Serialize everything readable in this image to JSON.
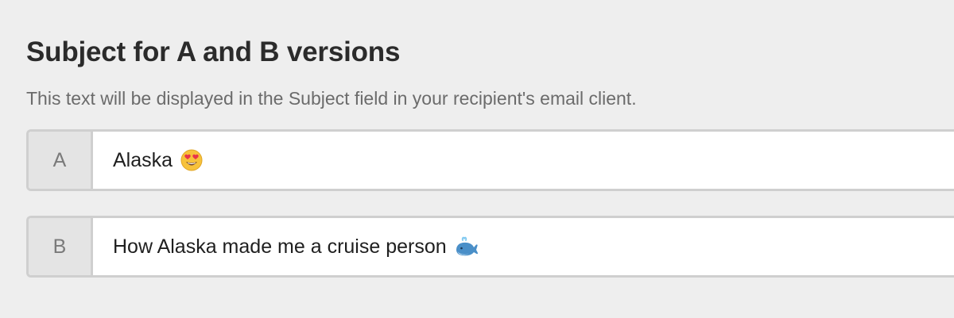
{
  "section": {
    "title": "Subject for A and B versions",
    "helper_text": "This text will be displayed in the Subject field in your recipient's email client."
  },
  "variants": [
    {
      "label": "A",
      "subject": "Alaska",
      "emoji_icon": "heart-eyes-emoji-icon"
    },
    {
      "label": "B",
      "subject": "How Alaska made me a cruise person",
      "emoji_icon": "whale-emoji-icon"
    }
  ],
  "colors": {
    "background": "#eeeeee",
    "heading": "#2b2b2b",
    "helper": "#6b6b6b",
    "border": "#cfcfcf",
    "label_bg": "#e4e4e4"
  }
}
